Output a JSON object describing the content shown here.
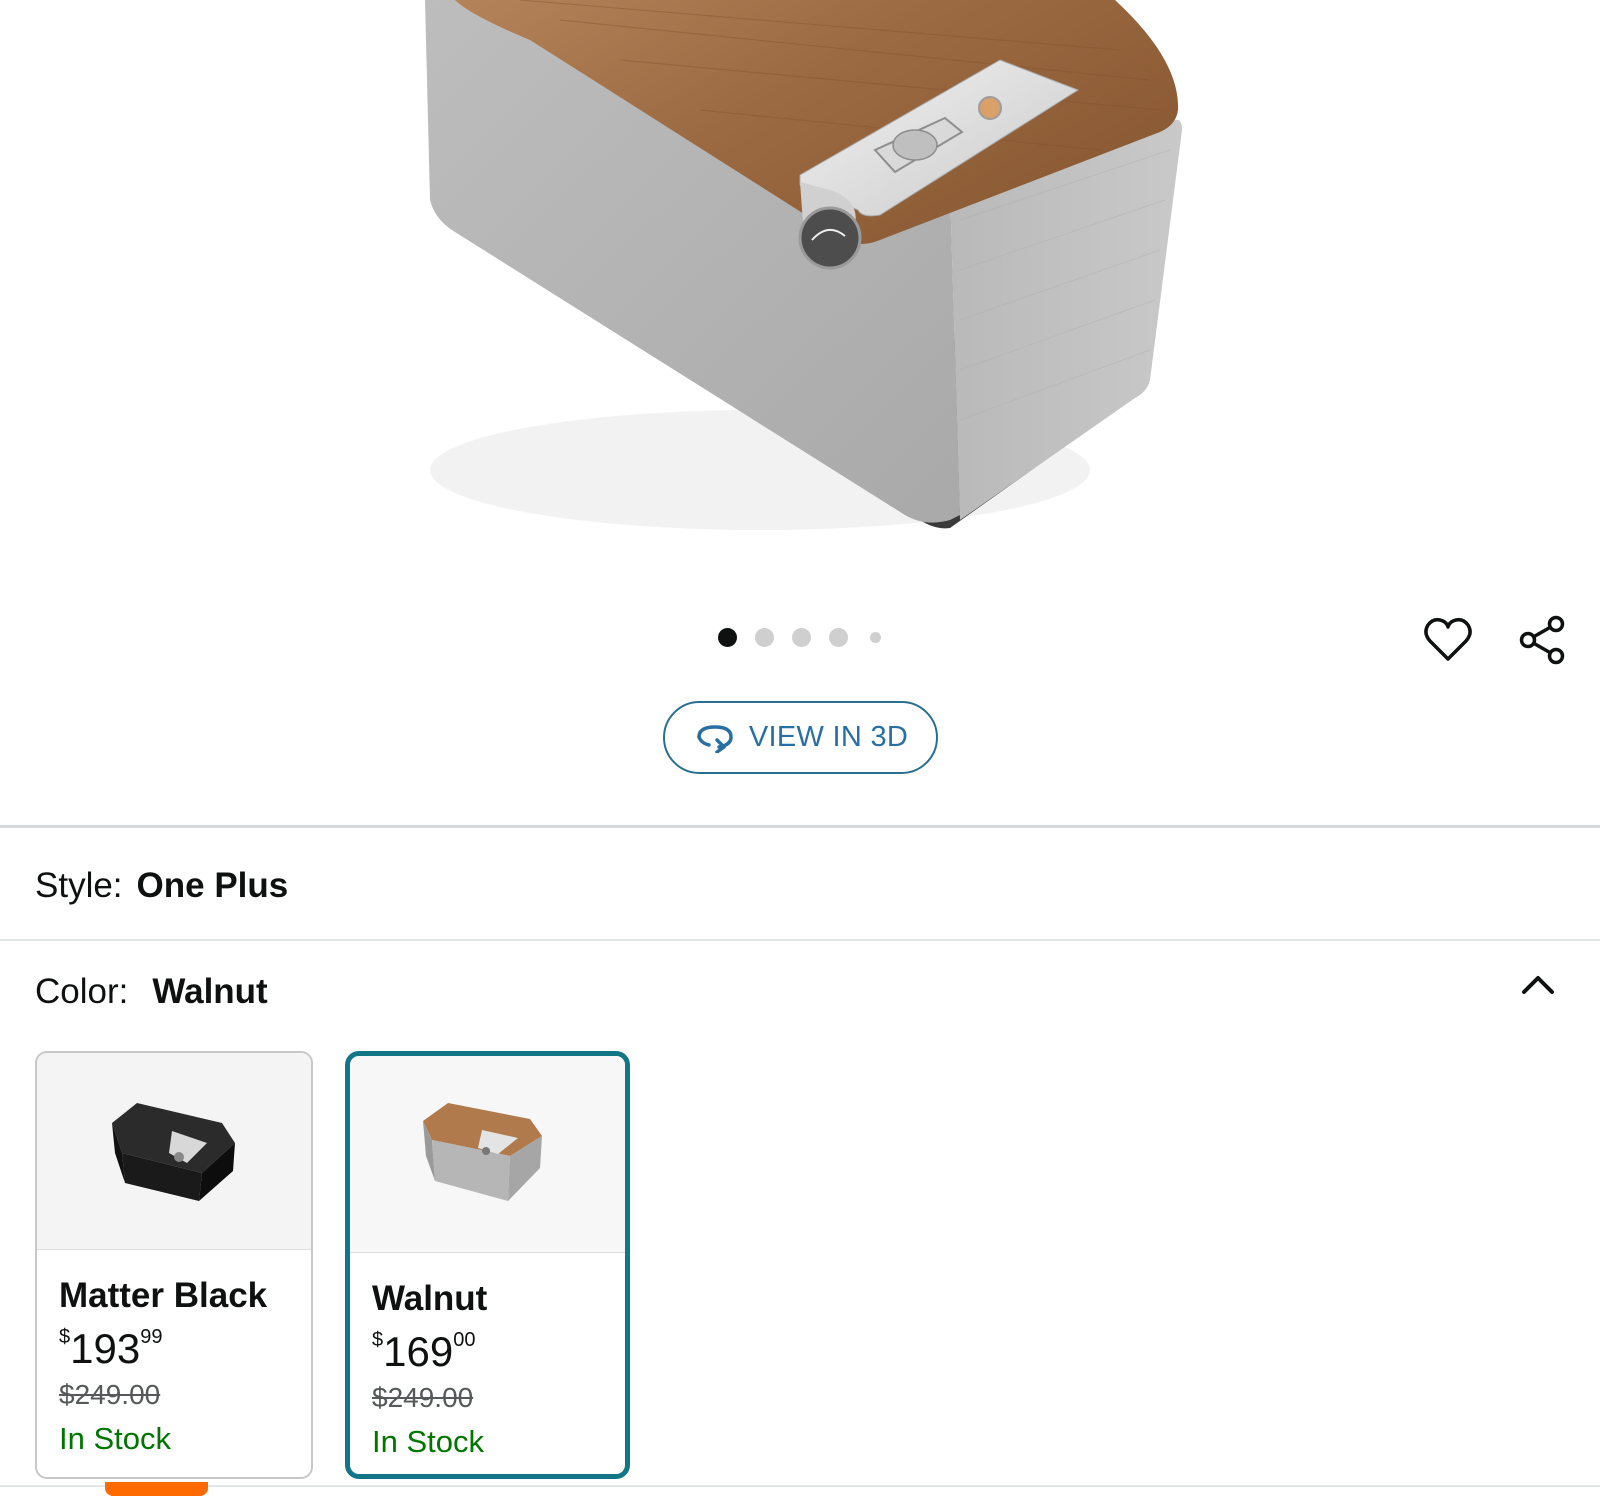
{
  "gallery": {
    "image_alt": "Klipsch speaker walnut",
    "dot_count": 5,
    "active_dot": 0,
    "wishlist_icon": "heart-icon",
    "share_icon": "share-icon",
    "view3d_icon": "rotate-3d-icon",
    "view3d_label": "VIEW IN 3D"
  },
  "style": {
    "label": "Style:",
    "value": "One Plus"
  },
  "color": {
    "label": "Color:",
    "value": "Walnut",
    "toggle_icon": "chevron-up-icon",
    "options": [
      {
        "name": "Matter Black",
        "price_symbol": "$",
        "price_whole": "193",
        "price_fraction": "99",
        "list_price": "$249.00",
        "availability": "In Stock",
        "selected": false
      },
      {
        "name": "Walnut",
        "price_symbol": "$",
        "price_whole": "169",
        "price_fraction": "00",
        "list_price": "$249.00",
        "availability": "In Stock",
        "selected": true
      }
    ]
  },
  "colors": {
    "selected_border": "#127686",
    "in_stock": "#007600",
    "link": "#2a6fa3",
    "accent": "#ff6a00"
  }
}
